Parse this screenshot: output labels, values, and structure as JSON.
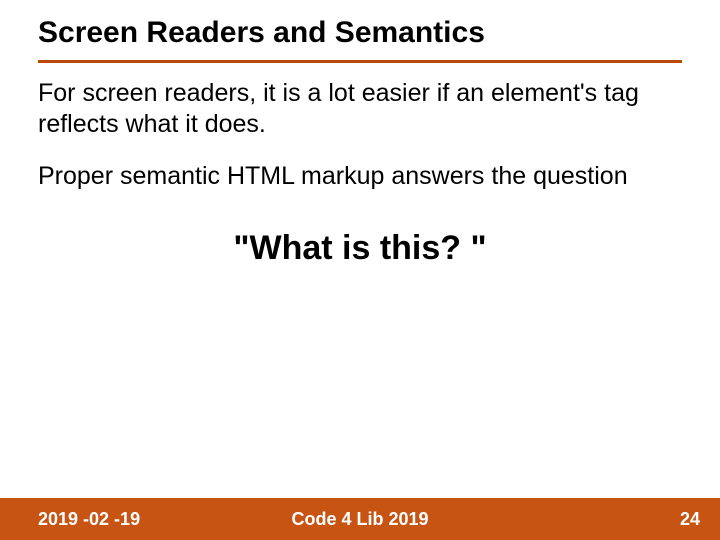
{
  "colors": {
    "accent": "#c75413",
    "rule": "#b84b0c",
    "text": "#000000",
    "footer_text": "#ffffff"
  },
  "slide": {
    "title": "Screen Readers and Semantics",
    "paragraph1": "For screen readers, it is a lot easier if an element's tag reflects what it does.",
    "paragraph2": "Proper semantic HTML markup answers the question",
    "callout": "\"What is this? \""
  },
  "footer": {
    "date": "2019 -02 -19",
    "event": "Code 4 Lib 2019",
    "page": "24"
  }
}
